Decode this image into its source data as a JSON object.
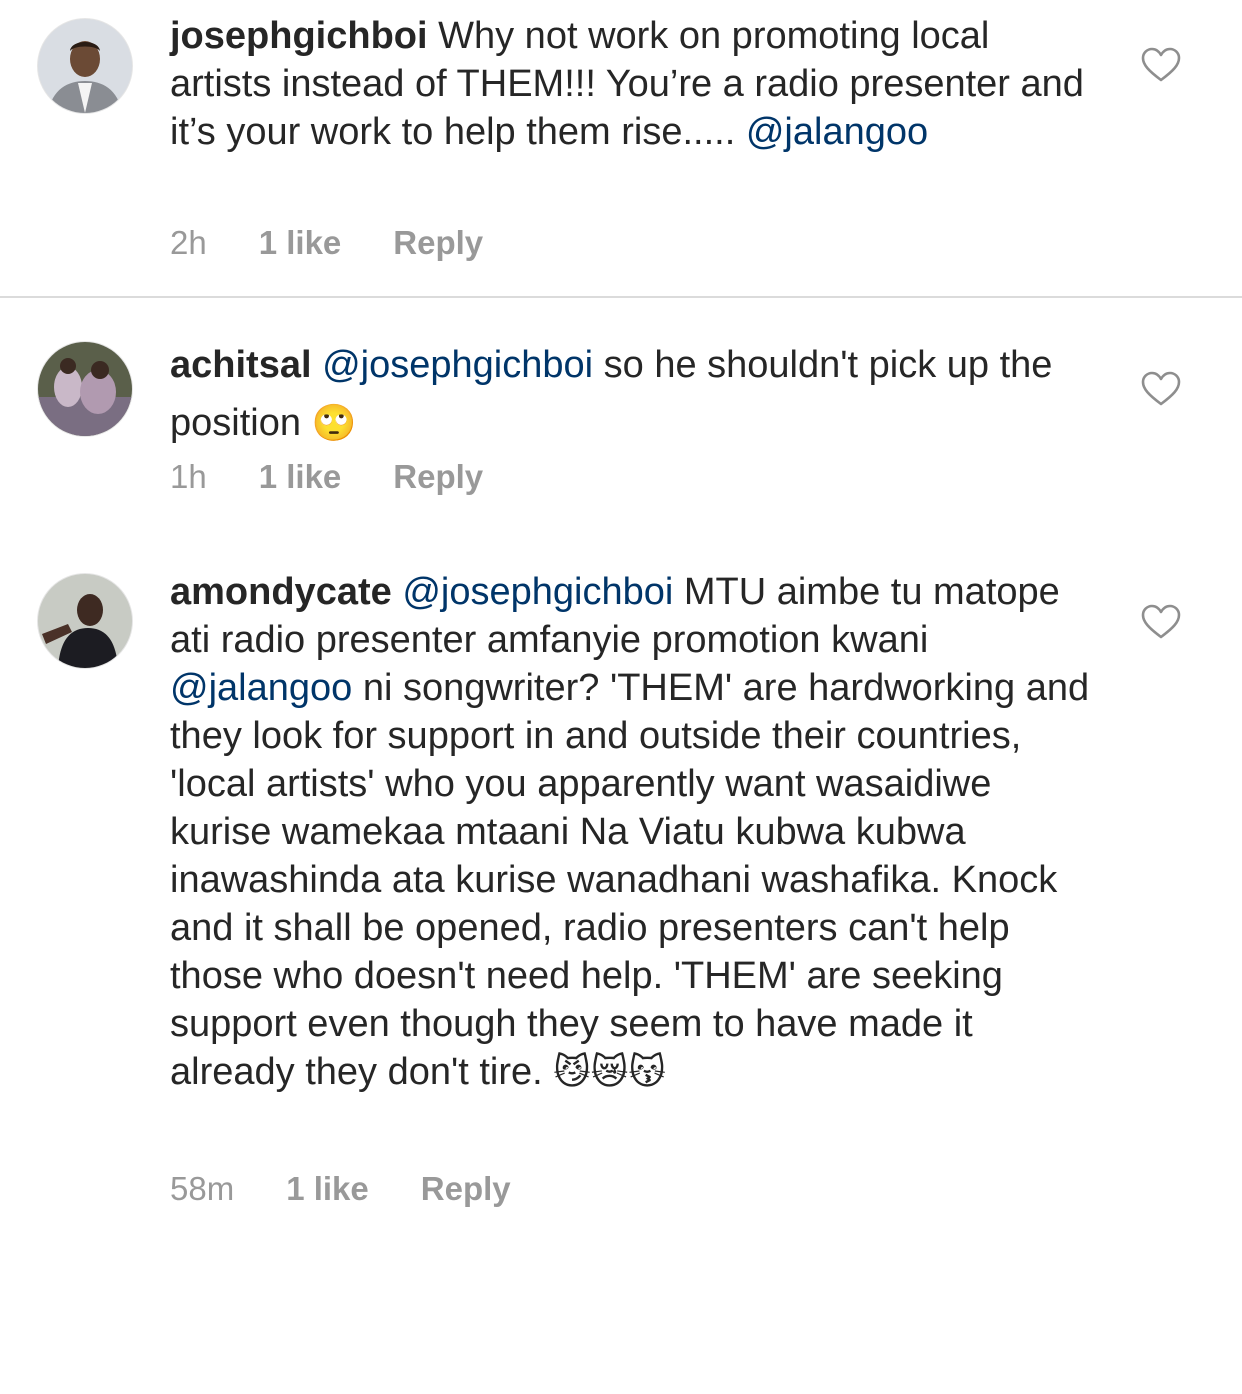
{
  "comments": [
    {
      "username": "josephgichboi",
      "parts": [
        "Why not work on promoting local artists instead of THEM!!! You’re a radio presenter and it’s your work to help them rise.....",
        "@jalangoo"
      ],
      "time": "2h",
      "likes": "1 like",
      "reply": "Reply",
      "avatar_icon": "profile-photo-man-in-suit",
      "heart_icon": "heart-outline-icon"
    },
    {
      "username": "achitsal",
      "parts": [
        "@josephgichboi",
        "so he shouldn't pick up the position",
        "🙄"
      ],
      "time": "1h",
      "likes": "1 like",
      "reply": "Reply",
      "avatar_icon": "profile-photo-group",
      "heart_icon": "heart-outline-icon"
    },
    {
      "username": "amondycate",
      "parts": [
        "@josephgichboi",
        "MTU aimbe tu matope ati radio presenter amfanyie promotion kwani",
        "@jalangoo",
        "ni songwriter? 'THEM' are hardworking and they look for support in and outside their countries, 'local artists' who you apparently want wasaidiwe kurise wamekaa mtaani Na Viatu kubwa kubwa inawashinda ata kurise wanadhani washafika. Knock and it shall be opened, radio presenters can't help those who doesn't need help. 'THEM' are seeking support even though they seem to have made it already they don't tire.",
        "😼😿😽"
      ],
      "time": "58m",
      "likes": "1 like",
      "reply": "Reply",
      "avatar_icon": "profile-photo-woman",
      "heart_icon": "heart-outline-icon"
    }
  ],
  "colors": {
    "text": "#262626",
    "mention": "#003569",
    "meta": "#999999",
    "divider": "#dbdbdb"
  }
}
